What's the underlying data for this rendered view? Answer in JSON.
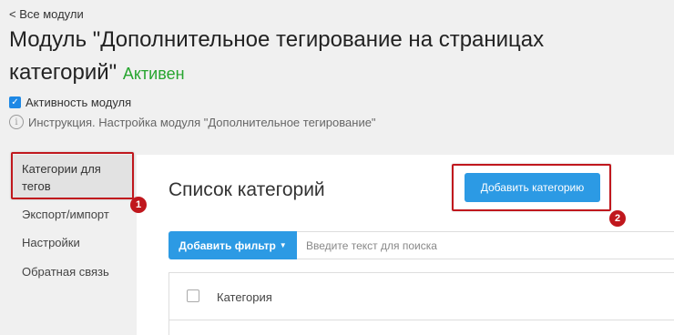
{
  "nav": {
    "back_label": "< Все модули"
  },
  "header": {
    "title": "Модуль \"Дополнительное тегирование на страницах категорий\"",
    "status": "Активен"
  },
  "settings": {
    "active_label": "Активность модуля",
    "active_checked": true,
    "instruction_label": "Инструкция. Настройка модуля \"Дополнительное тегирование\""
  },
  "sidebar": {
    "items": [
      {
        "label": "Категории для тегов",
        "active": true
      },
      {
        "label": "Экспорт/импорт"
      },
      {
        "label": "Настройки"
      },
      {
        "label": "Обратная связь"
      }
    ]
  },
  "main": {
    "title": "Список категорий",
    "add_category_label": "Добавить категорию",
    "add_filter_label": "Добавить фильтр",
    "search_placeholder": "Введите текст для поиска",
    "table_columns": [
      "Категория"
    ]
  },
  "annotations": {
    "badge_1": "1",
    "badge_2": "2",
    "highlight_color": "#c0171d"
  },
  "colors": {
    "accent": "#2c9ae4",
    "status_active": "#27a52f"
  }
}
